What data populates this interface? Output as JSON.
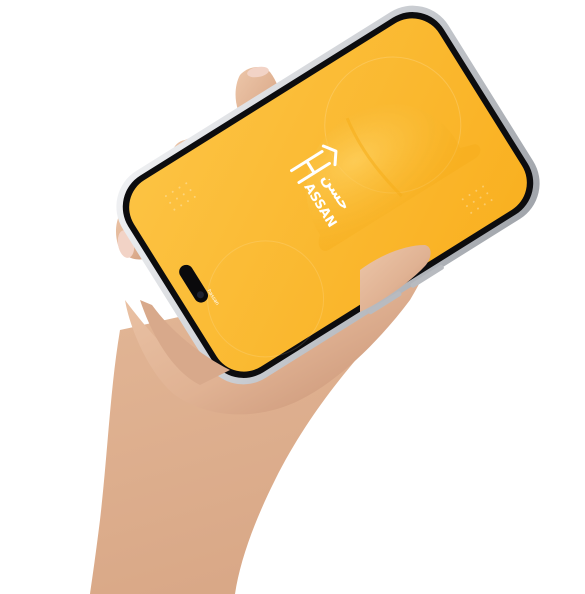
{
  "logo": {
    "latin_text": "ASSAN",
    "arabic_text": "حسن",
    "initial": "H"
  },
  "footer_brand": {
    "text": "hassan"
  },
  "colors": {
    "screen_yellow": "#FBB82B",
    "screen_yellow_light": "#FCC54A",
    "phone_frame": "#D9DBDE",
    "phone_bezel": "#0C0C0E",
    "skin": "#E3B99A",
    "skin_shadow": "#C9967A",
    "nail": "#F1D1C4"
  }
}
